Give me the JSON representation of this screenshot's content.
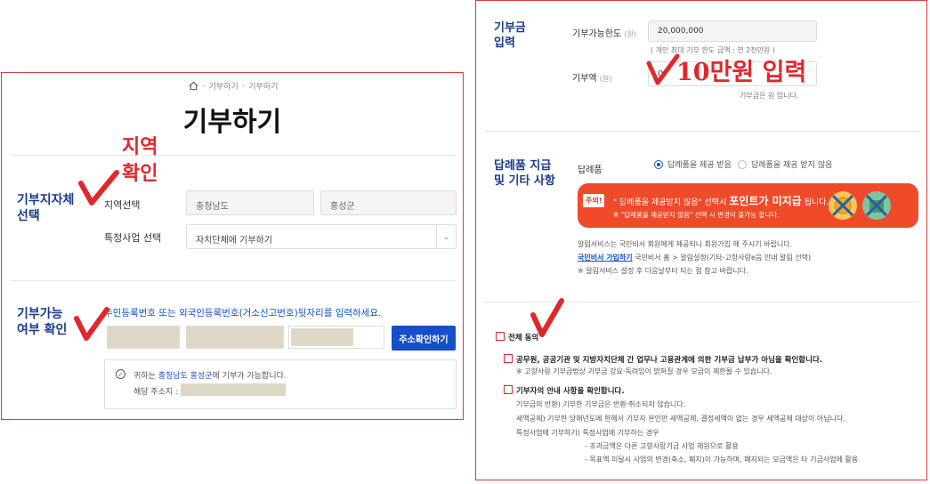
{
  "left": {
    "breadcrumb": {
      "item1": "기부하기",
      "item2": "기부하기"
    },
    "title": "기부하기",
    "section_region": "기부지자체\n선택",
    "region_label": "지역선택",
    "region_sido": "충청남도",
    "region_sigungu": "홍성군",
    "project_label": "특정사업 선택",
    "project_value": "자치단체에 기부하기",
    "section_eligibility": "기부가능\n여부 확인",
    "id_instruction": "주민등록번호 또는 외국인등록번호(거소신고번호)뒷자리를 입력하세요.",
    "address_button": "주소확인하기",
    "info_prefix": "귀하는 ",
    "info_region": "충청남도 홍성군",
    "info_suffix": "에 기부가 가능합니다.",
    "info_address_label": "해당 주소지 :",
    "annotation_region": "지역\n확인"
  },
  "right": {
    "section_amount": "기부금\n입력",
    "limit_label": "기부가능한도",
    "unit": "(원)",
    "limit_value": "20,000,000",
    "limit_note": "( 개인 최대 기부 한도 금액 : 연 2천만원 )",
    "amount_label": "기부액",
    "amount_value": "0",
    "amount_note": "기부금은 원 입니다.",
    "annotation_amount": "10만원 입력",
    "section_gift": "답례품 지급\n및 기타 사항",
    "gift_label": "답례품",
    "gift_opt_yes": "답례품을 제공 받음",
    "gift_opt_no": "답례품을 제공 받지 않음",
    "banner_tag": "주의!",
    "banner_line1_a": "\" 답례품을 제공받지 않음\" 선택시 ",
    "banner_line1_b": "포인트가 미지급",
    "banner_line1_c": " 됩니다.",
    "banner_line2": "※ \"답례품을 제공받지 않음\" 선택 시 변경이 불가능 합니다.",
    "alarm_line1": "알림서비스는 국민비서 회원에게 제공되니 회원가입 해 주시기 바랍니다.",
    "alarm_link": "국민비서 가입하기",
    "alarm_line2": " 국민비서 홈 > 알림설정(기타-고향사랑e음 안내 알림 선택)",
    "alarm_line3": "※ 알림서비스 설정 후 다음날부터 되는 점 참고 바랍니다.",
    "agree_all": "전체 동의",
    "agree1_title": "공무원, 공공기관 및 지방자치단체 간 업무나 고용관계에 의한 기부금 납부가 아님을 확인합니다.",
    "agree1_note": "※ 고향사랑 기부금법상 기부금 강요·독려임이 밝혀질 경우 모금이 제한될 수 있습니다.",
    "agree2_title": "기부자의 안내 사항을 확인합니다.",
    "agree2_l1": "기부금의 반환) 기부한 기부금은 반환·취소되지 않습니다.",
    "agree2_l2": "세액공제) 기부한 당해년도에 한해서 기부자 본인만 세액공제, 결정세액이 없는 경우 세액공제 대상이 아닙니다.",
    "agree2_l3": "특정사업에 기부하기) 특정사업에 기부하는 경우",
    "agree2_l4": "- 초과금액은 다른 고향사랑기금 사업 재원으로 활용",
    "agree2_l5": "- 목표액 미달시 사업의 변경(축소, 폐지)이 가능하며, 폐지되는 모금액은 타 기금사업에 활용"
  },
  "colors": {
    "accent": "#1550c8",
    "section": "#1a3a8a",
    "annotation": "#e0282c",
    "banner": "#ef4a2a"
  }
}
